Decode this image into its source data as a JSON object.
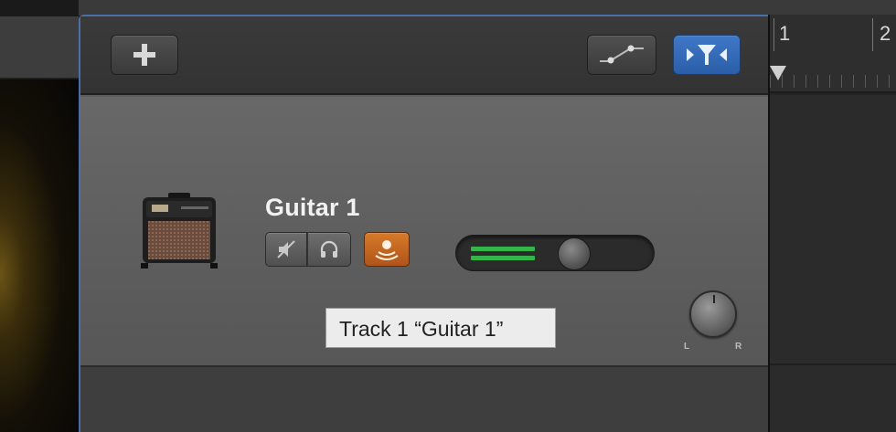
{
  "track": {
    "name": "Guitar 1",
    "tooltip": "Track 1 “Guitar 1”",
    "volume_level": 0.62,
    "pan_level": 0.5,
    "buttons": {
      "mute_icon": "mute-speaker-icon",
      "solo_icon": "headphones-icon",
      "monitor_icon": "input-monitoring-icon"
    },
    "pan_labels": {
      "left": "L",
      "right": "R"
    }
  },
  "header": {
    "add_icon": "plus-icon",
    "automation_icon": "automation-curve-icon",
    "filter_icon": "catch-playhead-filter-icon"
  },
  "ruler": {
    "bars": [
      "1",
      "2"
    ]
  },
  "colors": {
    "selection_border": "#4a6ea7",
    "active_blue": "#3f78c8",
    "monitor_orange": "#d67a2a",
    "meter_green": "#33b54a"
  }
}
